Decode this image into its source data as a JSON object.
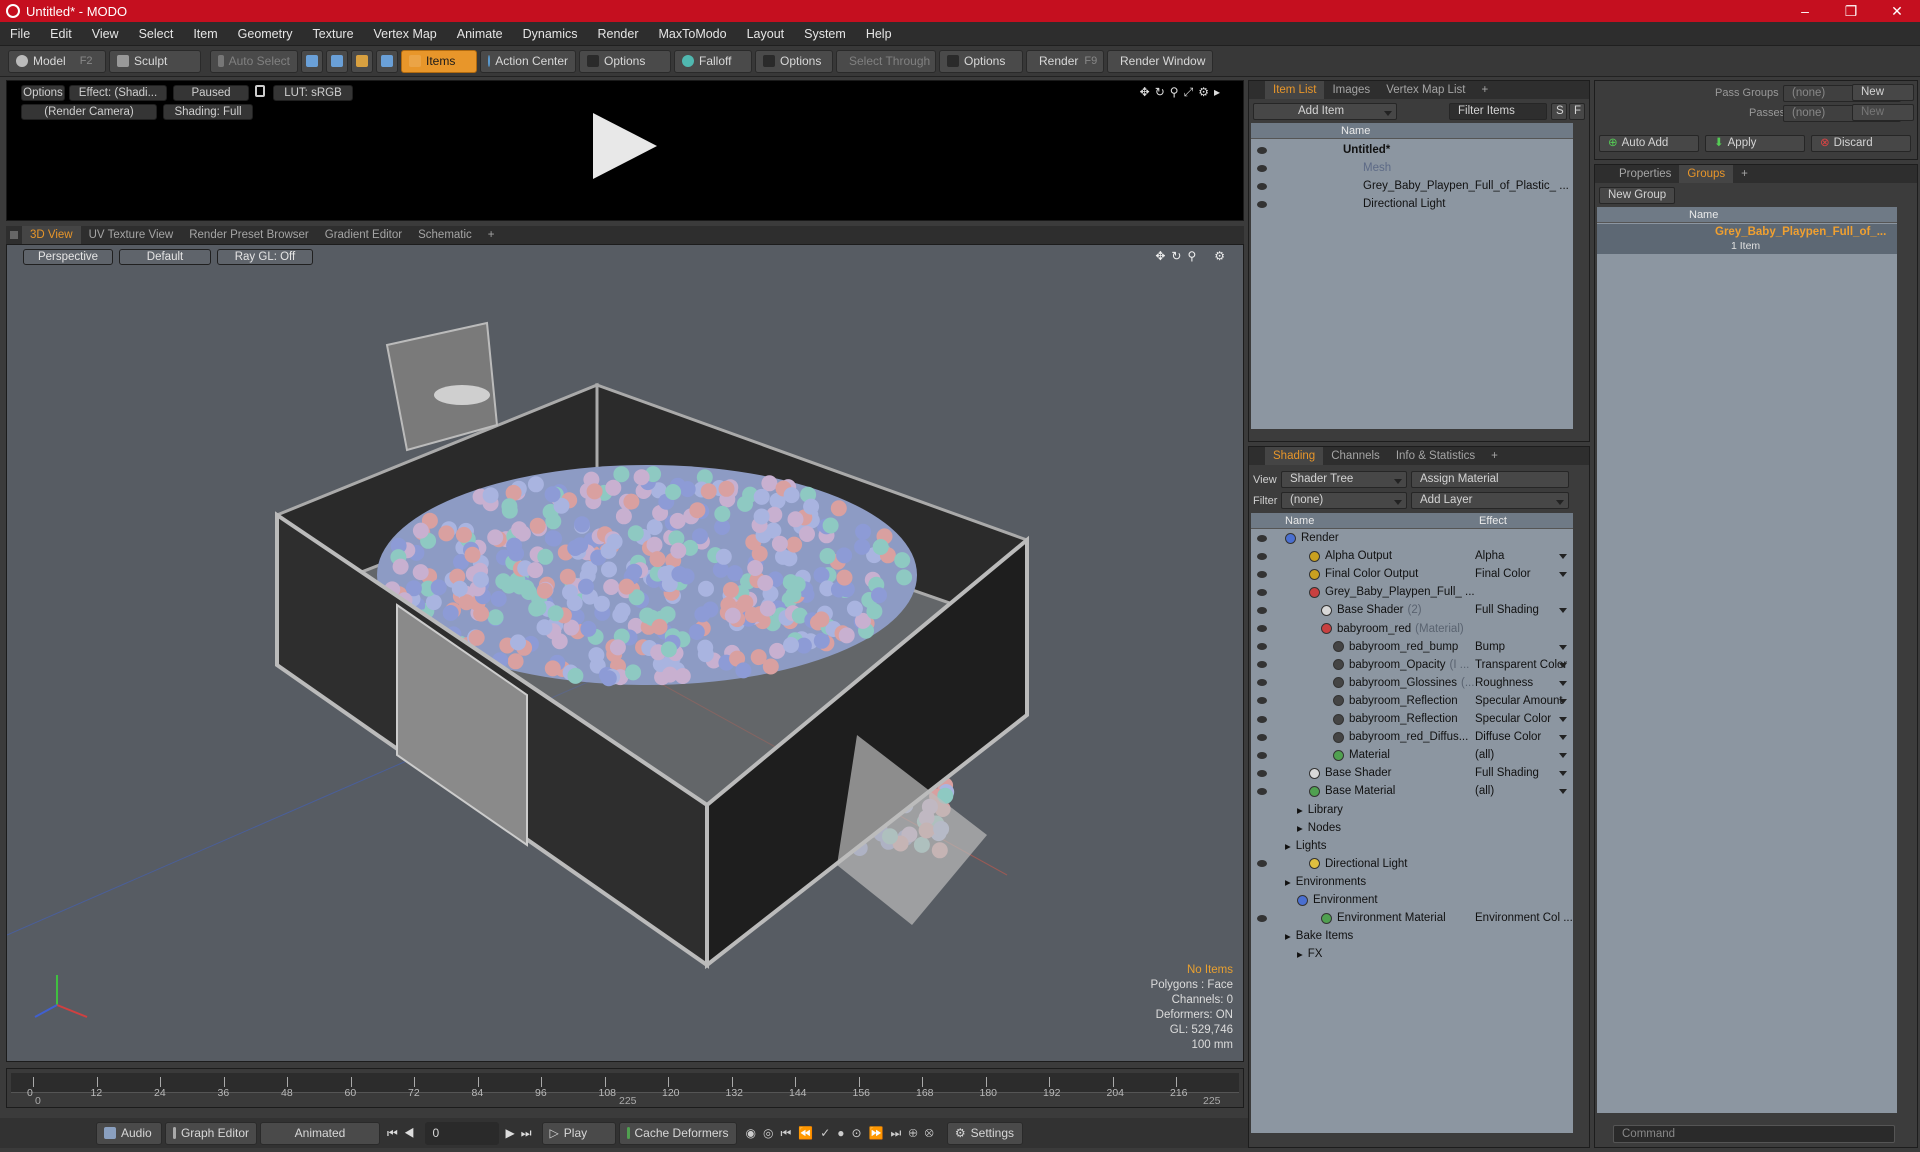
{
  "window": {
    "title": "Untitled* - MODO"
  },
  "menu": [
    "File",
    "Edit",
    "View",
    "Select",
    "Item",
    "Geometry",
    "Texture",
    "Vertex Map",
    "Animate",
    "Dynamics",
    "Render",
    "MaxToModo",
    "Layout",
    "System",
    "Help"
  ],
  "toolbar": {
    "model": "Model",
    "model_key": "F2",
    "sculpt": "Sculpt",
    "auto_select": "Auto Select",
    "items": "Items",
    "action_center": "Action Center",
    "options1": "Options",
    "falloff": "Falloff",
    "options2": "Options",
    "select_through": "Select Through",
    "options3": "Options",
    "render": "Render",
    "render_key": "F9",
    "render_window": "Render Window"
  },
  "renderview": {
    "options": "Options",
    "effect": "Effect: (Shadi...",
    "paused": "Paused",
    "lut": "LUT: sRGB",
    "camera": "(Render Camera)",
    "shading": "Shading: Full"
  },
  "viewtabs": [
    "3D View",
    "UV Texture View",
    "Render Preset Browser",
    "Gradient Editor",
    "Schematic",
    "+"
  ],
  "viewport": {
    "perspective": "Perspective",
    "default": "Default",
    "raygl": "Ray GL: Off",
    "hud": {
      "no_items": "No Items",
      "polygons": "Polygons : Face",
      "channels": "Channels: 0",
      "deformers": "Deformers: ON",
      "gl": "GL: 529,746",
      "scale": "100 mm"
    }
  },
  "timeline": {
    "ticks": [
      "0",
      "12",
      "24",
      "36",
      "48",
      "60",
      "72",
      "84",
      "96",
      "108",
      "120",
      "132",
      "144",
      "156",
      "168",
      "180",
      "192",
      "204",
      "216"
    ],
    "start": "0",
    "mid": "225",
    "end": "225"
  },
  "bottom": {
    "audio": "Audio",
    "graph_editor": "Graph Editor",
    "animated": "Animated",
    "frame": "0",
    "play": "Play",
    "cache": "Cache Deformers",
    "settings": "Settings"
  },
  "itemlist": {
    "tabs": [
      "Item List",
      "Images",
      "Vertex Map List",
      "+"
    ],
    "add_item": "Add Item",
    "filter": "Filter Items",
    "f_btn": "F",
    "s_btn": "S",
    "col_name": "Name",
    "items": [
      {
        "label": "Untitled*",
        "indent": 0
      },
      {
        "label": "Mesh",
        "indent": 1
      },
      {
        "label": "Grey_Baby_Playpen_Full_of_Plastic_ ...",
        "indent": 1
      },
      {
        "label": "Directional Light",
        "indent": 1
      }
    ]
  },
  "shading": {
    "tabs": [
      "Shading",
      "Channels",
      "Info & Statistics",
      "+"
    ],
    "view_lbl": "View",
    "view_val": "Shader Tree",
    "assign": "Assign Material",
    "filter_lbl": "Filter",
    "filter_val": "(none)",
    "add_layer": "Add Layer",
    "col_name": "Name",
    "col_effect": "Effect",
    "rows": [
      {
        "name": "Render",
        "sub": "",
        "effect": "",
        "indent": 0,
        "color": "#4a6fd0"
      },
      {
        "name": "Alpha Output",
        "sub": "",
        "effect": "Alpha",
        "indent": 2,
        "color": "#c9a020"
      },
      {
        "name": "Final Color Output",
        "sub": "",
        "effect": "Final Color",
        "indent": 2,
        "color": "#c9a020"
      },
      {
        "name": "Grey_Baby_Playpen_Full_ ...",
        "sub": "",
        "effect": "",
        "indent": 2,
        "color": "#c84040"
      },
      {
        "name": "Base Shader",
        "sub": "(2)",
        "effect": "Full Shading",
        "indent": 3,
        "color": "#d8d8d8"
      },
      {
        "name": "babyroom_red",
        "sub": "(Material)",
        "effect": "",
        "indent": 3,
        "color": "#c84040"
      },
      {
        "name": "babyroom_red_bump",
        "sub": "",
        "effect": "Bump",
        "indent": 4,
        "color": "#444"
      },
      {
        "name": "babyroom_Opacity",
        "sub": "(I ...",
        "effect": "Transparent Color",
        "indent": 4,
        "color": "#444"
      },
      {
        "name": "babyroom_Glossines",
        "sub": "(...",
        "effect": "Roughness",
        "indent": 4,
        "color": "#444"
      },
      {
        "name": "babyroom_Reflection",
        "sub": "",
        "effect": "Specular Amount",
        "indent": 4,
        "color": "#444"
      },
      {
        "name": "babyroom_Reflection",
        "sub": "",
        "effect": "Specular Color",
        "indent": 4,
        "color": "#444"
      },
      {
        "name": "babyroom_red_Diffus...",
        "sub": "",
        "effect": "Diffuse Color",
        "indent": 4,
        "color": "#444"
      },
      {
        "name": "Material",
        "sub": "",
        "effect": "(all)",
        "indent": 4,
        "color": "#50a050"
      },
      {
        "name": "Base Shader",
        "sub": "",
        "effect": "Full Shading",
        "indent": 2,
        "color": "#d8d8d8"
      },
      {
        "name": "Base Material",
        "sub": "",
        "effect": "(all)",
        "indent": 2,
        "color": "#50a050"
      },
      {
        "name": "Library",
        "sub": "",
        "effect": "",
        "indent": 1,
        "color": ""
      },
      {
        "name": "Nodes",
        "sub": "",
        "effect": "",
        "indent": 1,
        "color": ""
      },
      {
        "name": "Lights",
        "sub": "",
        "effect": "",
        "indent": 0,
        "color": ""
      },
      {
        "name": "Directional Light",
        "sub": "",
        "effect": "",
        "indent": 2,
        "color": "#e0c040"
      },
      {
        "name": "Environments",
        "sub": "",
        "effect": "",
        "indent": 0,
        "color": ""
      },
      {
        "name": "Environment",
        "sub": "",
        "effect": "",
        "indent": 1,
        "color": "#4a6fd0"
      },
      {
        "name": "Environment Material",
        "sub": "",
        "effect": "Environment Col ...",
        "indent": 3,
        "color": "#50a050"
      },
      {
        "name": "Bake Items",
        "sub": "",
        "effect": "",
        "indent": 0,
        "color": ""
      },
      {
        "name": "FX",
        "sub": "",
        "effect": "",
        "indent": 1,
        "color": ""
      }
    ]
  },
  "passes": {
    "pass_groups": "Pass Groups",
    "pass_val": "(none)",
    "new": "New",
    "passes": "Passes",
    "passes_val": "(none)",
    "new2": "New",
    "auto_add": "Auto Add",
    "apply": "Apply",
    "discard": "Discard"
  },
  "groups": {
    "tabs": [
      "Properties",
      "Groups",
      "+"
    ],
    "new_group": "New Group",
    "col_name": "Name",
    "item_name": "Grey_Baby_Playpen_Full_of_...",
    "item_count": "1 Item"
  },
  "command": {
    "placeholder": "Command"
  }
}
